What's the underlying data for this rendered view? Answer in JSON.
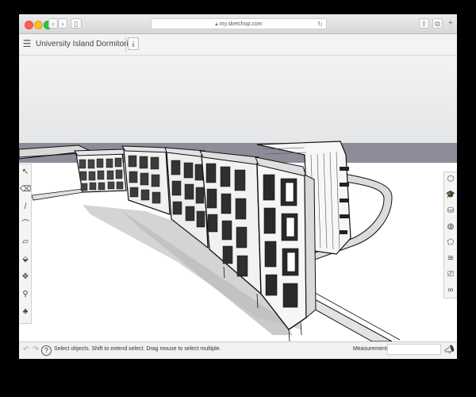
{
  "browser": {
    "url": "my.sketchup.com",
    "back_icon": "‹",
    "forward_icon": "›",
    "sidebar_icon": "▯",
    "lock_icon": "🔒",
    "reload_icon": "↻",
    "share_icon": "⇪",
    "tabs_icon": "⧉",
    "newtab_icon": "+"
  },
  "app": {
    "menu_icon": "☰",
    "title": "University Island Dormitories",
    "export_icon": "⤓"
  },
  "left_toolbar": [
    {
      "name": "select-tool",
      "icon": "↖"
    },
    {
      "name": "eraser-tool",
      "icon": "⌫"
    },
    {
      "name": "line-tool",
      "icon": "/"
    },
    {
      "name": "arc-tool",
      "icon": "⌒"
    },
    {
      "name": "rectangle-tool",
      "icon": "▱"
    },
    {
      "name": "push-pull-tool",
      "icon": "⬙"
    },
    {
      "name": "move-tool",
      "icon": "✥"
    },
    {
      "name": "orbit-tool",
      "icon": "⚲"
    },
    {
      "name": "paint-bucket-tool",
      "icon": "♣"
    }
  ],
  "right_toolbar": [
    {
      "name": "entity-info-panel",
      "icon": "⬡"
    },
    {
      "name": "instructor-panel",
      "icon": "🎓"
    },
    {
      "name": "components-panel",
      "icon": "⛁"
    },
    {
      "name": "materials-panel",
      "icon": "◍"
    },
    {
      "name": "styles-panel",
      "icon": "⬠"
    },
    {
      "name": "layers-panel",
      "icon": "≋"
    },
    {
      "name": "scenes-panel",
      "icon": "⎚"
    },
    {
      "name": "display-panel",
      "icon": "∞"
    }
  ],
  "status": {
    "undo_icon": "↶",
    "redo_icon": "↷",
    "help_icon": "?",
    "text": "Select objects. Shift to extend select. Drag mouse to select multiple.",
    "measurements_label": "Measurements",
    "measurements_value": "",
    "feedback_icon": "📣"
  },
  "colors": {
    "horizon": "#8c8d99",
    "sky": "#eceeef",
    "ground": "#ffffff"
  }
}
